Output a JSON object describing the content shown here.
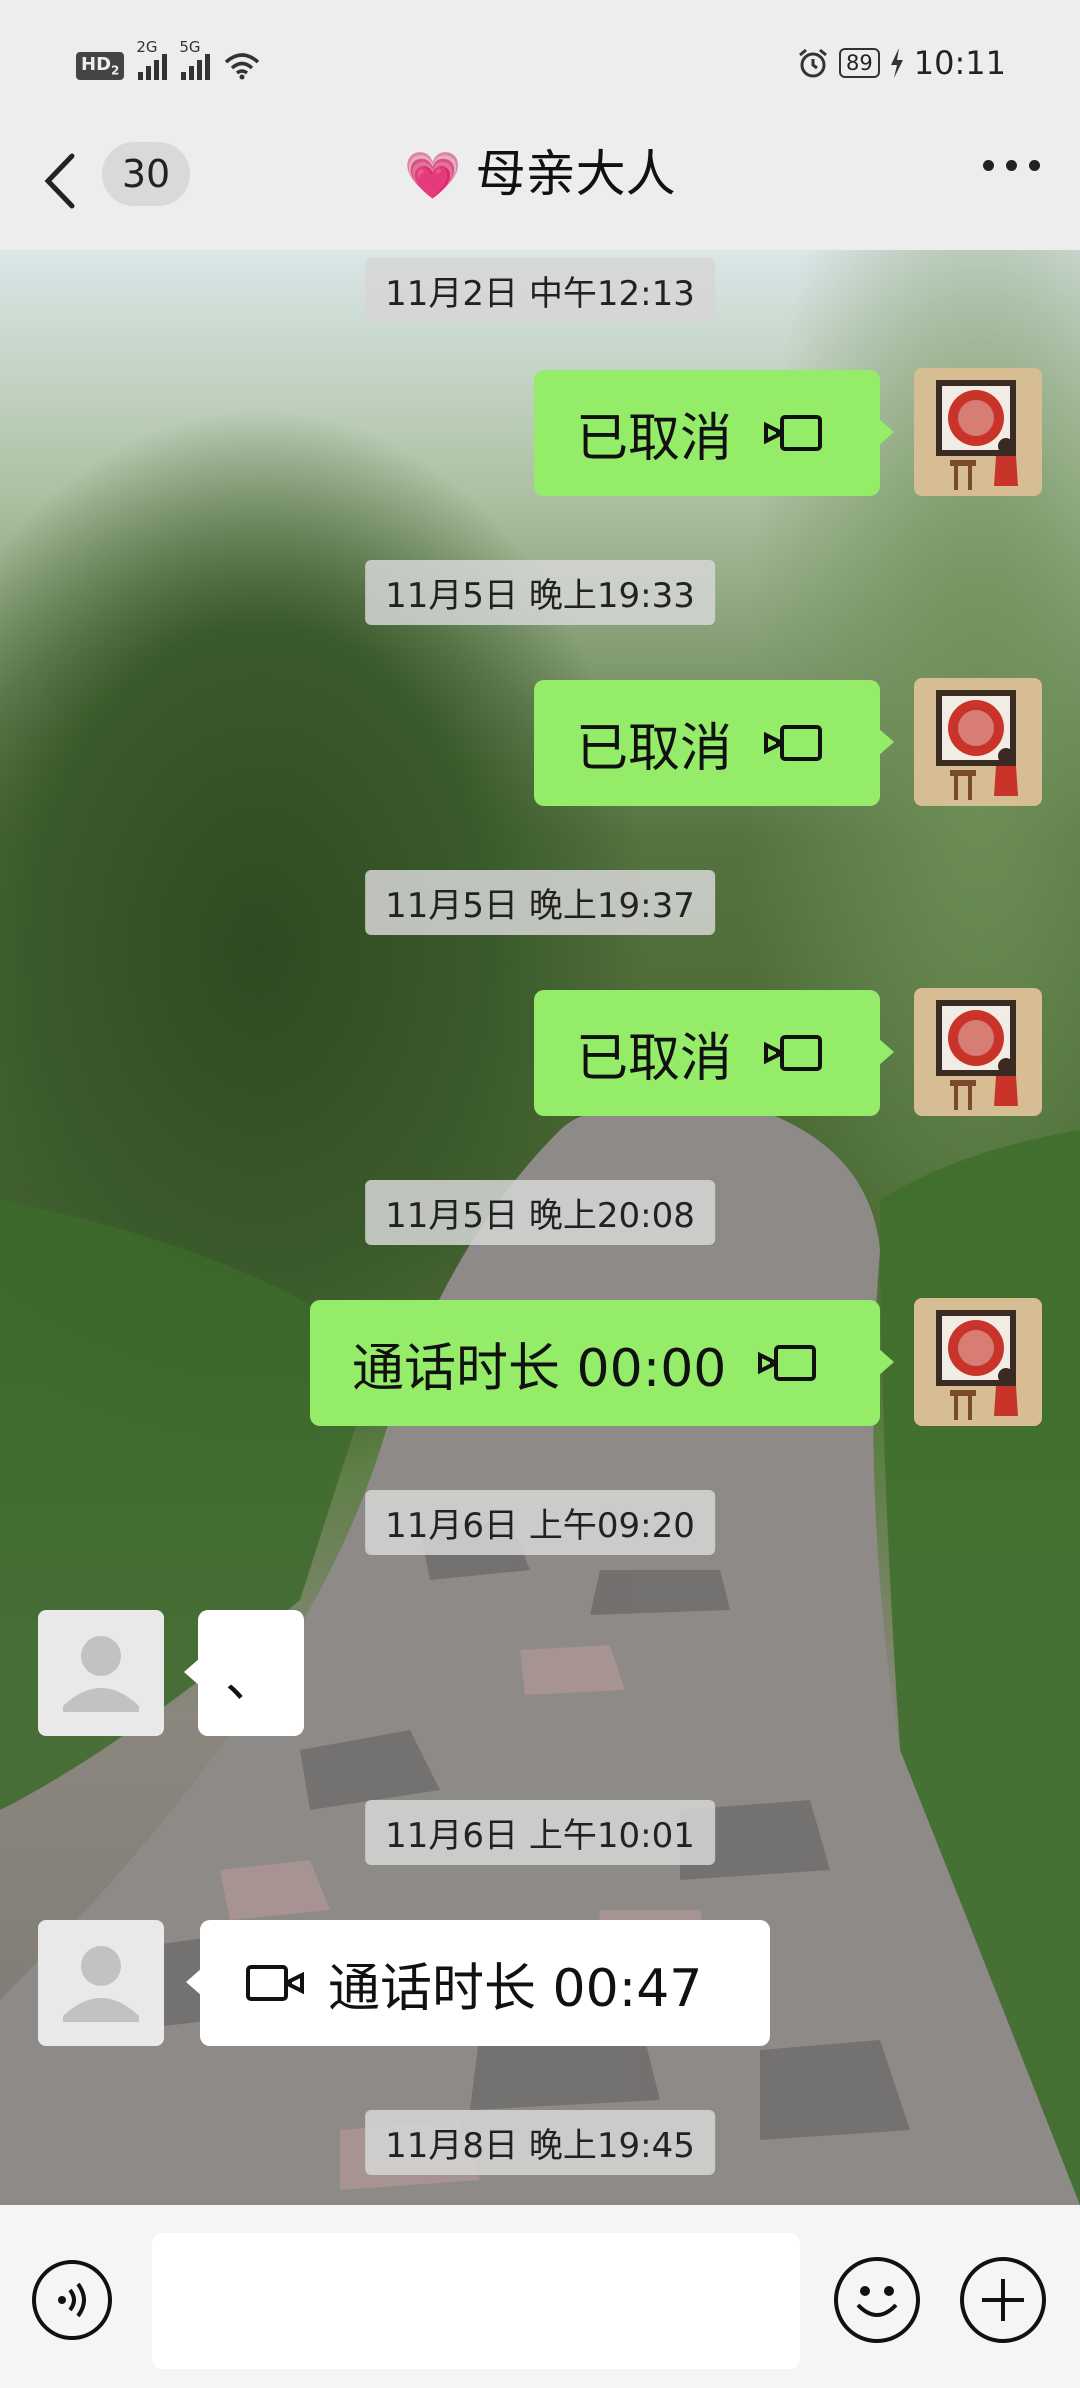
{
  "status_bar": {
    "hd": "HD",
    "hd_sub": "2",
    "net1": "2G",
    "net2": "5G",
    "battery": "89",
    "time": "10:11"
  },
  "header": {
    "unread_count": "30",
    "contact_name": "母亲大人"
  },
  "messages": [
    {
      "type": "timestamp",
      "text": "11月2日 中午12:13"
    },
    {
      "type": "call",
      "side": "me",
      "text": "已取消"
    },
    {
      "type": "timestamp",
      "text": "11月5日 晚上19:33"
    },
    {
      "type": "call",
      "side": "me",
      "text": "已取消"
    },
    {
      "type": "timestamp",
      "text": "11月5日 晚上19:37"
    },
    {
      "type": "call",
      "side": "me",
      "text": "已取消"
    },
    {
      "type": "timestamp",
      "text": "11月5日 晚上20:08"
    },
    {
      "type": "call",
      "side": "me",
      "text": "通话时长 00:00"
    },
    {
      "type": "timestamp",
      "text": "11月6日 上午09:20"
    },
    {
      "type": "text",
      "side": "other",
      "text": "、"
    },
    {
      "type": "timestamp",
      "text": "11月6日 上午10:01"
    },
    {
      "type": "call",
      "side": "other",
      "text": "通话时长 00:47"
    },
    {
      "type": "timestamp",
      "text": "11月8日 晚上19:45"
    }
  ],
  "colors": {
    "my_bubble": "#95ec69",
    "other_bubble": "#ffffff",
    "bar_bg": "#ededed"
  },
  "icons": [
    "back-icon",
    "more-icon",
    "video-call-icon",
    "voice-input-icon",
    "emoji-icon",
    "plus-icon"
  ]
}
